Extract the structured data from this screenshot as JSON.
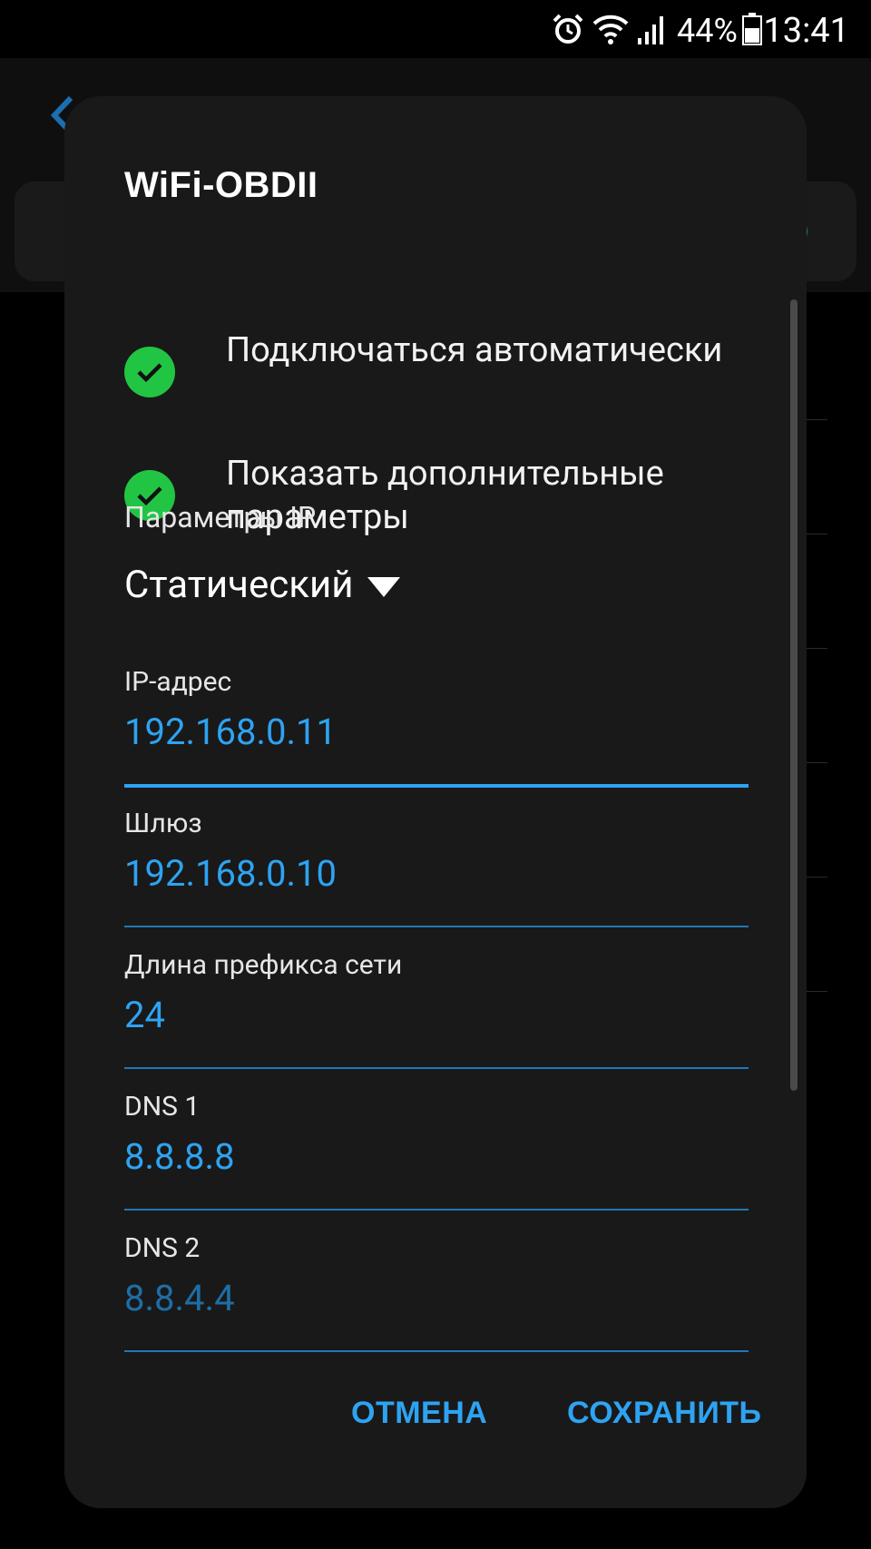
{
  "status_bar": {
    "time": "13:41",
    "battery_percent": "44%",
    "icons": [
      "alarm-icon",
      "wifi-icon",
      "signal-icon",
      "battery-icon"
    ]
  },
  "dialog": {
    "title": "WiFi-OBDII",
    "options": [
      {
        "label": "Подключаться автоматически",
        "checked": true
      },
      {
        "label": "Показать дополнительные параметры",
        "checked": true
      }
    ],
    "ip_settings_label": "Параметры IP",
    "ip_settings_value": "Статический",
    "fields": [
      {
        "label": "IP-адрес",
        "value": "192.168.0.11",
        "focused": true,
        "hint": false
      },
      {
        "label": "Шлюз",
        "value": "192.168.0.10",
        "focused": false,
        "hint": false
      },
      {
        "label": "Длина префикса сети",
        "value": "24",
        "focused": false,
        "hint": false
      },
      {
        "label": "DNS 1",
        "value": "8.8.8.8",
        "focused": false,
        "hint": false
      },
      {
        "label": "DNS 2",
        "value": "8.8.4.4",
        "focused": false,
        "hint": true
      }
    ],
    "cancel_label": "ОТМЕНА",
    "save_label": "СОХРАНИТЬ"
  },
  "colors": {
    "accent": "#2ea3f2",
    "check_green": "#21c543",
    "dialog_bg": "#191919"
  }
}
